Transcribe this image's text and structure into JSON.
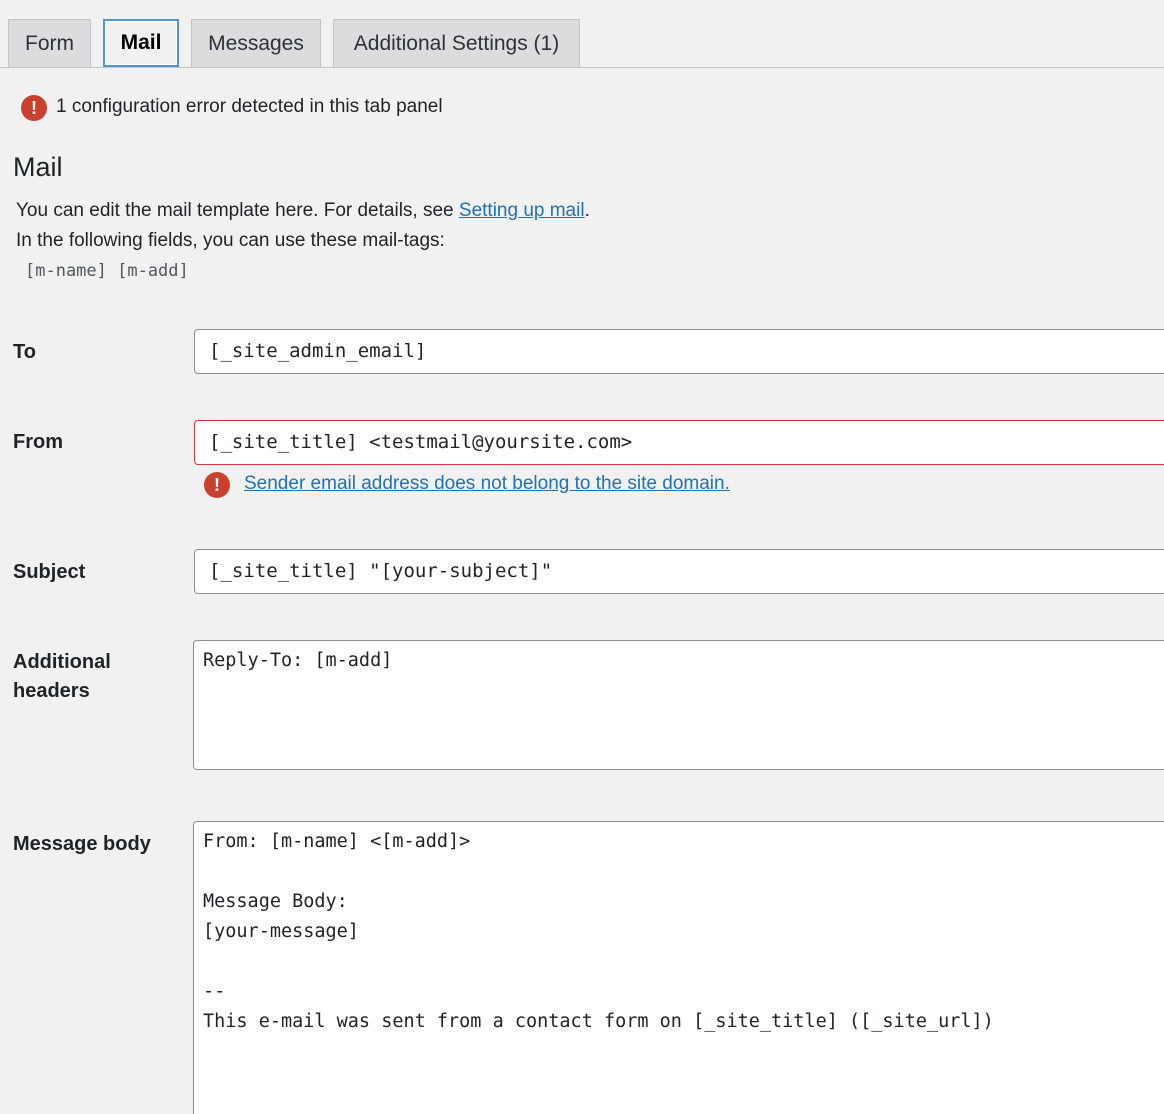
{
  "tabs": [
    {
      "label": "Form"
    },
    {
      "label": "Mail"
    },
    {
      "label": "Messages"
    },
    {
      "label": "Additional Settings (1)"
    }
  ],
  "config_error": {
    "icon": "!",
    "text": "1 configuration error detected in this tab panel"
  },
  "section": {
    "title": "Mail",
    "desc_line1_prefix": "You can edit the mail template here. For details, see ",
    "desc_link": "Setting up mail",
    "desc_line1_suffix": ".",
    "desc_line2": "In the following fields, you can use these mail-tags:",
    "mail_tags": "[m-name] [m-add]"
  },
  "fields": {
    "to": {
      "label": "To",
      "value": "[_site_admin_email]"
    },
    "from": {
      "label": "From",
      "value": "[_site_title] <testmail@yoursite.com>",
      "error_icon": "!",
      "error": "Sender email address does not belong to the site domain."
    },
    "subject": {
      "label": "Subject",
      "value": "[_site_title] \"[your-subject]\""
    },
    "additional_headers": {
      "label_line1": "Additional",
      "label_line2": "headers",
      "value": "Reply-To: [m-add]"
    },
    "message_body": {
      "label": "Message body",
      "value": "From: [m-name] <[m-add]>\n\nMessage Body:\n[your-message]\n\n-- \nThis e-mail was sent from a contact form on [_site_title] ([_site_url])"
    }
  },
  "colors": {
    "accent": "#2271b1",
    "error": "#c9412d",
    "invalid_border": "#d63638"
  }
}
